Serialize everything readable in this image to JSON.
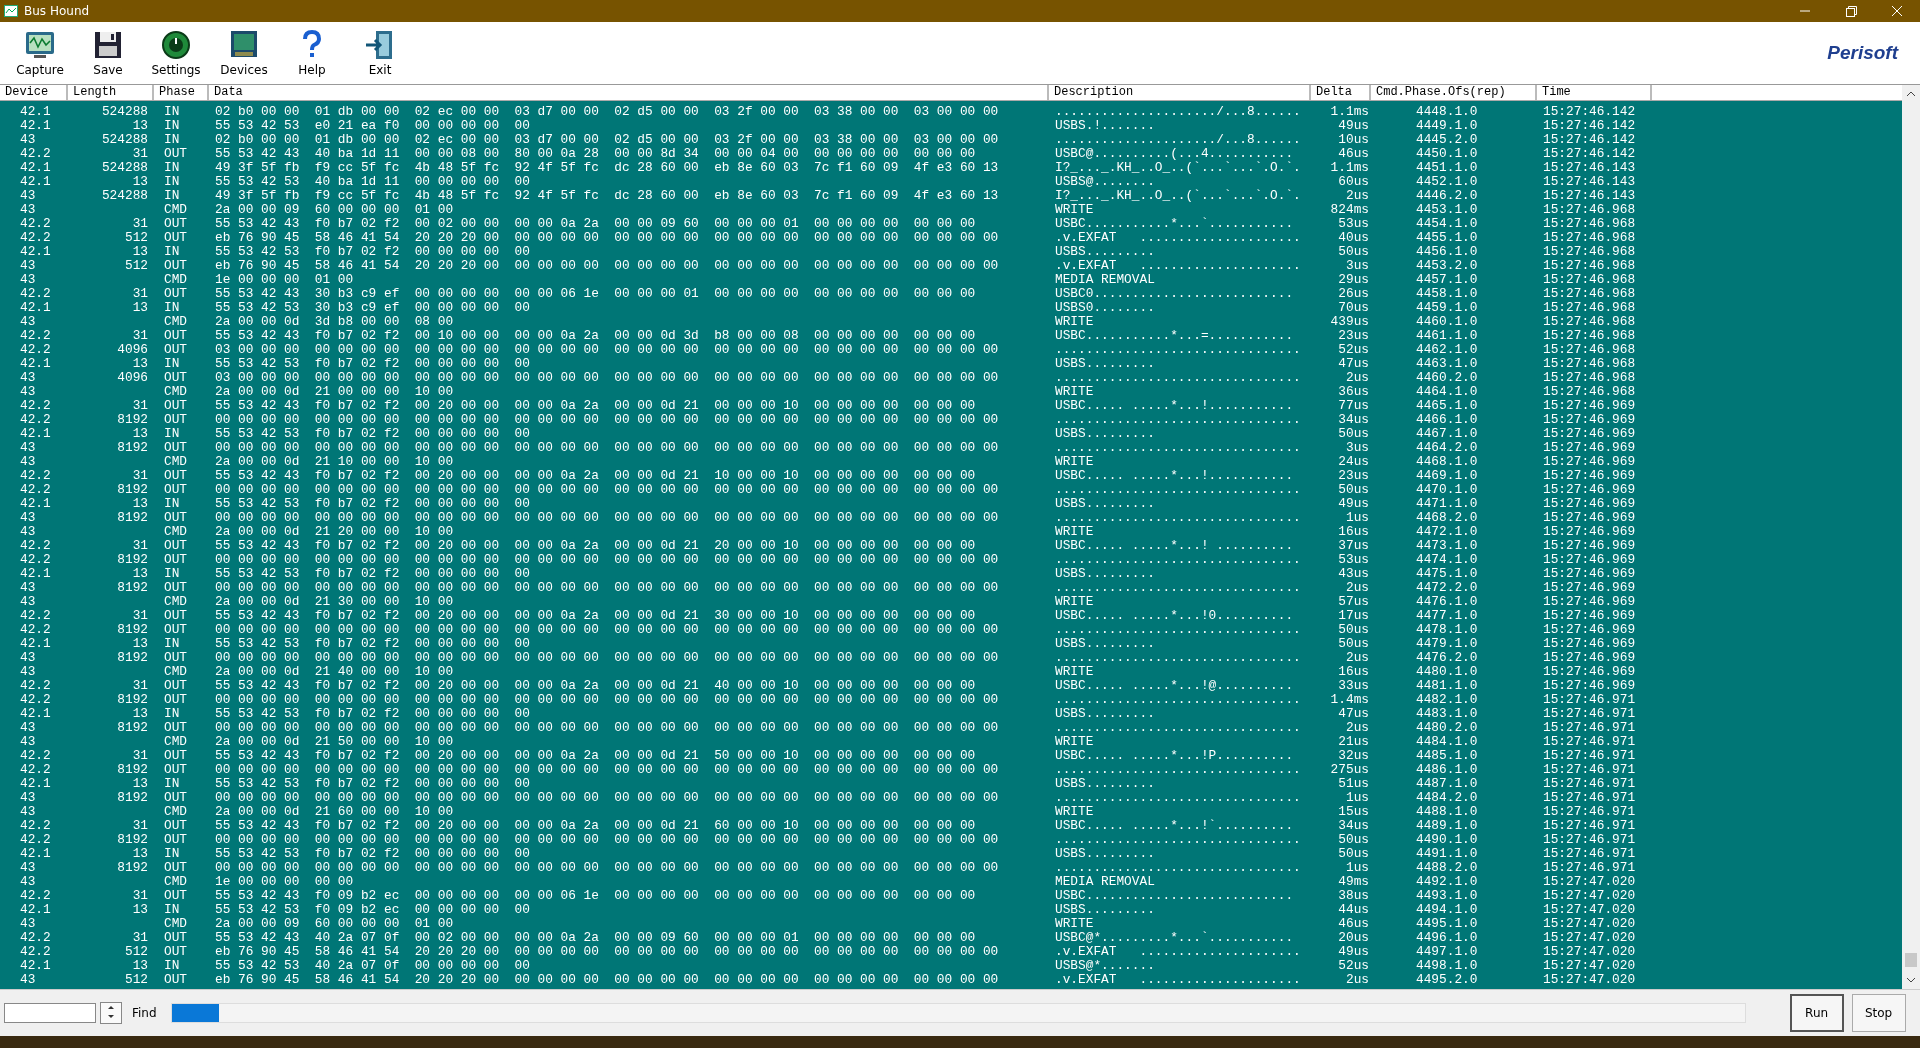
{
  "window": {
    "title": "Bus Hound"
  },
  "toolbar": [
    {
      "label": "Capture",
      "kind": "capture"
    },
    {
      "label": "Save",
      "kind": "save"
    },
    {
      "label": "Settings",
      "kind": "settings"
    },
    {
      "label": "Devices",
      "kind": "devices"
    },
    {
      "label": "Help",
      "kind": "help"
    },
    {
      "label": "Exit",
      "kind": "exit"
    }
  ],
  "logo": "Perisoft",
  "table": {
    "columns": [
      "Device",
      "Length",
      "Phase",
      "Data",
      "Description",
      "Delta",
      "Cmd.Phase.Ofs(rep)",
      "Time"
    ],
    "rows": [
      {
        "device": "42.1",
        "length": "524288",
        "phase": "IN",
        "data": "02 b0 00 00  01 db 00 00  02 ec 00 00  03 d7 00 00  02 d5 00 00  03 2f 00 00  03 38 00 00  03 00 00 00",
        "description": "...................../...8......",
        "delta": "1.1ms",
        "cmd": "4448.1.0",
        "time": "15:27:46.142"
      },
      {
        "device": "42.1",
        "length": "13",
        "phase": "IN",
        "data": "55 53 42 53  e0 21 ea f0  00 00 00 00  00",
        "description": "USBS.!.......",
        "delta": "49us",
        "cmd": "4449.1.0",
        "time": "15:27:46.142"
      },
      {
        "device": "43",
        "length": "524288",
        "phase": "IN",
        "data": "02 b0 00 00  01 db 00 00  02 ec 00 00  03 d7 00 00  02 d5 00 00  03 2f 00 00  03 38 00 00  03 00 00 00",
        "description": "...................../...8......",
        "delta": "10us",
        "cmd": "4445.2.0",
        "time": "15:27:46.142"
      },
      {
        "device": "42.2",
        "length": "31",
        "phase": "OUT",
        "data": "55 53 42 43  40 ba 1d 11  00 00 08 00  80 00 0a 28  00 00 8d 34  00 00 04 00  00 00 00 00  00 00 00",
        "description": "USBC@..........(...4...........",
        "delta": "46us",
        "cmd": "4450.1.0",
        "time": "15:27:46.142"
      },
      {
        "device": "42.1",
        "length": "524288",
        "phase": "IN",
        "data": "49 3f 5f fb  f9 cc 5f fc  4b 48 5f fc  92 4f 5f fc  dc 28 60 00  eb 8e 60 03  7c f1 60 09  4f e3 60 13",
        "description": "I?_..._.KH_..O_..(`...`...`.O.`.",
        "delta": "1.1ms",
        "cmd": "4451.1.0",
        "time": "15:27:46.143"
      },
      {
        "device": "42.1",
        "length": "13",
        "phase": "IN",
        "data": "55 53 42 53  40 ba 1d 11  00 00 00 00  00",
        "description": "USBS@........",
        "delta": "60us",
        "cmd": "4452.1.0",
        "time": "15:27:46.143"
      },
      {
        "device": "43",
        "length": "524288",
        "phase": "IN",
        "data": "49 3f 5f fb  f9 cc 5f fc  4b 48 5f fc  92 4f 5f fc  dc 28 60 00  eb 8e 60 03  7c f1 60 09  4f e3 60 13",
        "description": "I?_..._.KH_..O_..(`...`...`.O.`.",
        "delta": "2us",
        "cmd": "4446.2.0",
        "time": "15:27:46.143"
      },
      {
        "device": "43",
        "phase": "CMD",
        "data": "2a 00 00 09  60 00 00 00  01 00",
        "description": "WRITE",
        "delta": "824ms",
        "cmd": "4453.1.0",
        "time": "15:27:46.968"
      },
      {
        "device": "42.2",
        "length": "31",
        "phase": "OUT",
        "data": "55 53 42 43  f0 b7 02 f2  00 02 00 00  00 00 0a 2a  00 00 09 60  00 00 00 01  00 00 00 00  00 00 00",
        "description": "USBC...........*...`...........",
        "delta": "53us",
        "cmd": "4454.1.0",
        "time": "15:27:46.968"
      },
      {
        "device": "42.2",
        "length": "512",
        "phase": "OUT",
        "data": "eb 76 90 45  58 46 41 54  20 20 20 00  00 00 00 00  00 00 00 00  00 00 00 00  00 00 00 00  00 00 00 00",
        "description": ".v.EXFAT   .....................",
        "delta": "40us",
        "cmd": "4455.1.0",
        "time": "15:27:46.968"
      },
      {
        "device": "42.1",
        "length": "13",
        "phase": "IN",
        "data": "55 53 42 53  f0 b7 02 f2  00 00 00 00  00",
        "description": "USBS.........",
        "delta": "50us",
        "cmd": "4456.1.0",
        "time": "15:27:46.968"
      },
      {
        "device": "43",
        "length": "512",
        "phase": "OUT",
        "data": "eb 76 90 45  58 46 41 54  20 20 20 00  00 00 00 00  00 00 00 00  00 00 00 00  00 00 00 00  00 00 00 00",
        "description": ".v.EXFAT   .....................",
        "delta": "3us",
        "cmd": "4453.2.0",
        "time": "15:27:46.968"
      },
      {
        "device": "43",
        "phase": "CMD",
        "data": "1e 00 00 00  01 00",
        "description": "MEDIA REMOVAL",
        "delta": "29us",
        "cmd": "4457.1.0",
        "time": "15:27:46.968"
      },
      {
        "device": "42.2",
        "length": "31",
        "phase": "OUT",
        "data": "55 53 42 43  30 b3 c9 ef  00 00 00 00  00 00 06 1e  00 00 00 01  00 00 00 00  00 00 00 00  00 00 00",
        "description": "USBC0..........................",
        "delta": "26us",
        "cmd": "4458.1.0",
        "time": "15:27:46.968"
      },
      {
        "device": "42.1",
        "length": "13",
        "phase": "IN",
        "data": "55 53 42 53  30 b3 c9 ef  00 00 00 00  00",
        "description": "USBS0........",
        "delta": "70us",
        "cmd": "4459.1.0",
        "time": "15:27:46.968"
      },
      {
        "device": "43",
        "phase": "CMD",
        "data": "2a 00 00 0d  3d b8 00 00  08 00",
        "description": "WRITE",
        "delta": "439us",
        "cmd": "4460.1.0",
        "time": "15:27:46.968"
      },
      {
        "device": "42.2",
        "length": "31",
        "phase": "OUT",
        "data": "55 53 42 43  f0 b7 02 f2  00 10 00 00  00 00 0a 2a  00 00 0d 3d  b8 00 00 08  00 00 00 00  00 00 00",
        "description": "USBC...........*...=...........",
        "delta": "23us",
        "cmd": "4461.1.0",
        "time": "15:27:46.968"
      },
      {
        "device": "42.2",
        "length": "4096",
        "phase": "OUT",
        "data": "03 00 00 00  00 00 00 00  00 00 00 00  00 00 00 00  00 00 00 00  00 00 00 00  00 00 00 00  00 00 00 00",
        "description": "................................",
        "delta": "52us",
        "cmd": "4462.1.0",
        "time": "15:27:46.968"
      },
      {
        "device": "42.1",
        "length": "13",
        "phase": "IN",
        "data": "55 53 42 53  f0 b7 02 f2  00 00 00 00  00",
        "description": "USBS.........",
        "delta": "47us",
        "cmd": "4463.1.0",
        "time": "15:27:46.968"
      },
      {
        "device": "43",
        "length": "4096",
        "phase": "OUT",
        "data": "03 00 00 00  00 00 00 00  00 00 00 00  00 00 00 00  00 00 00 00  00 00 00 00  00 00 00 00  00 00 00 00",
        "description": "................................",
        "delta": "2us",
        "cmd": "4460.2.0",
        "time": "15:27:46.968"
      },
      {
        "device": "43",
        "phase": "CMD",
        "data": "2a 00 00 0d  21 00 00 00  10 00",
        "description": "WRITE",
        "delta": "36us",
        "cmd": "4464.1.0",
        "time": "15:27:46.968"
      },
      {
        "device": "42.2",
        "length": "31",
        "phase": "OUT",
        "data": "55 53 42 43  f0 b7 02 f2  00 20 00 00  00 00 0a 2a  00 00 0d 21  00 00 00 10  00 00 00 00  00 00 00",
        "description": "USBC..... .....*...!...........",
        "delta": "77us",
        "cmd": "4465.1.0",
        "time": "15:27:46.969"
      },
      {
        "device": "42.2",
        "length": "8192",
        "phase": "OUT",
        "data": "00 00 00 00  00 00 00 00  00 00 00 00  00 00 00 00  00 00 00 00  00 00 00 00  00 00 00 00  00 00 00 00",
        "description": "................................",
        "delta": "34us",
        "cmd": "4466.1.0",
        "time": "15:27:46.969"
      },
      {
        "device": "42.1",
        "length": "13",
        "phase": "IN",
        "data": "55 53 42 53  f0 b7 02 f2  00 00 00 00  00",
        "description": "USBS.........",
        "delta": "50us",
        "cmd": "4467.1.0",
        "time": "15:27:46.969"
      },
      {
        "device": "43",
        "length": "8192",
        "phase": "OUT",
        "data": "00 00 00 00  00 00 00 00  00 00 00 00  00 00 00 00  00 00 00 00  00 00 00 00  00 00 00 00  00 00 00 00",
        "description": "................................",
        "delta": "3us",
        "cmd": "4464.2.0",
        "time": "15:27:46.969"
      },
      {
        "device": "43",
        "phase": "CMD",
        "data": "2a 00 00 0d  21 10 00 00  10 00",
        "description": "WRITE",
        "delta": "24us",
        "cmd": "4468.1.0",
        "time": "15:27:46.969"
      },
      {
        "device": "42.2",
        "length": "31",
        "phase": "OUT",
        "data": "55 53 42 43  f0 b7 02 f2  00 20 00 00  00 00 0a 2a  00 00 0d 21  10 00 00 10  00 00 00 00  00 00 00",
        "description": "USBC..... .....*...!...........",
        "delta": "23us",
        "cmd": "4469.1.0",
        "time": "15:27:46.969"
      },
      {
        "device": "42.2",
        "length": "8192",
        "phase": "OUT",
        "data": "00 00 00 00  00 00 00 00  00 00 00 00  00 00 00 00  00 00 00 00  00 00 00 00  00 00 00 00  00 00 00 00",
        "description": "................................",
        "delta": "50us",
        "cmd": "4470.1.0",
        "time": "15:27:46.969"
      },
      {
        "device": "42.1",
        "length": "13",
        "phase": "IN",
        "data": "55 53 42 53  f0 b7 02 f2  00 00 00 00  00",
        "description": "USBS.........",
        "delta": "49us",
        "cmd": "4471.1.0",
        "time": "15:27:46.969"
      },
      {
        "device": "43",
        "length": "8192",
        "phase": "OUT",
        "data": "00 00 00 00  00 00 00 00  00 00 00 00  00 00 00 00  00 00 00 00  00 00 00 00  00 00 00 00  00 00 00 00",
        "description": "................................",
        "delta": "1us",
        "cmd": "4468.2.0",
        "time": "15:27:46.969"
      },
      {
        "device": "43",
        "phase": "CMD",
        "data": "2a 00 00 0d  21 20 00 00  10 00",
        "description": "WRITE",
        "delta": "16us",
        "cmd": "4472.1.0",
        "time": "15:27:46.969"
      },
      {
        "device": "42.2",
        "length": "31",
        "phase": "OUT",
        "data": "55 53 42 43  f0 b7 02 f2  00 20 00 00  00 00 0a 2a  00 00 0d 21  20 00 00 10  00 00 00 00  00 00 00",
        "description": "USBC..... .....*...! ..........",
        "delta": "37us",
        "cmd": "4473.1.0",
        "time": "15:27:46.969"
      },
      {
        "device": "42.2",
        "length": "8192",
        "phase": "OUT",
        "data": "00 00 00 00  00 00 00 00  00 00 00 00  00 00 00 00  00 00 00 00  00 00 00 00  00 00 00 00  00 00 00 00",
        "description": "................................",
        "delta": "53us",
        "cmd": "4474.1.0",
        "time": "15:27:46.969"
      },
      {
        "device": "42.1",
        "length": "13",
        "phase": "IN",
        "data": "55 53 42 53  f0 b7 02 f2  00 00 00 00  00",
        "description": "USBS.........",
        "delta": "43us",
        "cmd": "4475.1.0",
        "time": "15:27:46.969"
      },
      {
        "device": "43",
        "length": "8192",
        "phase": "OUT",
        "data": "00 00 00 00  00 00 00 00  00 00 00 00  00 00 00 00  00 00 00 00  00 00 00 00  00 00 00 00  00 00 00 00",
        "description": "................................",
        "delta": "2us",
        "cmd": "4472.2.0",
        "time": "15:27:46.969"
      },
      {
        "device": "43",
        "phase": "CMD",
        "data": "2a 00 00 0d  21 30 00 00  10 00",
        "description": "WRITE",
        "delta": "57us",
        "cmd": "4476.1.0",
        "time": "15:27:46.969"
      },
      {
        "device": "42.2",
        "length": "31",
        "phase": "OUT",
        "data": "55 53 42 43  f0 b7 02 f2  00 20 00 00  00 00 0a 2a  00 00 0d 21  30 00 00 10  00 00 00 00  00 00 00",
        "description": "USBC..... .....*...!0..........",
        "delta": "17us",
        "cmd": "4477.1.0",
        "time": "15:27:46.969"
      },
      {
        "device": "42.2",
        "length": "8192",
        "phase": "OUT",
        "data": "00 00 00 00  00 00 00 00  00 00 00 00  00 00 00 00  00 00 00 00  00 00 00 00  00 00 00 00  00 00 00 00",
        "description": "................................",
        "delta": "50us",
        "cmd": "4478.1.0",
        "time": "15:27:46.969"
      },
      {
        "device": "42.1",
        "length": "13",
        "phase": "IN",
        "data": "55 53 42 53  f0 b7 02 f2  00 00 00 00  00",
        "description": "USBS.........",
        "delta": "50us",
        "cmd": "4479.1.0",
        "time": "15:27:46.969"
      },
      {
        "device": "43",
        "length": "8192",
        "phase": "OUT",
        "data": "00 00 00 00  00 00 00 00  00 00 00 00  00 00 00 00  00 00 00 00  00 00 00 00  00 00 00 00  00 00 00 00",
        "description": "................................",
        "delta": "2us",
        "cmd": "4476.2.0",
        "time": "15:27:46.969"
      },
      {
        "device": "43",
        "phase": "CMD",
        "data": "2a 00 00 0d  21 40 00 00  10 00",
        "description": "WRITE",
        "delta": "16us",
        "cmd": "4480.1.0",
        "time": "15:27:46.969"
      },
      {
        "device": "42.2",
        "length": "31",
        "phase": "OUT",
        "data": "55 53 42 43  f0 b7 02 f2  00 20 00 00  00 00 0a 2a  00 00 0d 21  40 00 00 10  00 00 00 00  00 00 00",
        "description": "USBC..... .....*...!@..........",
        "delta": "33us",
        "cmd": "4481.1.0",
        "time": "15:27:46.969"
      },
      {
        "device": "42.2",
        "length": "8192",
        "phase": "OUT",
        "data": "00 00 00 00  00 00 00 00  00 00 00 00  00 00 00 00  00 00 00 00  00 00 00 00  00 00 00 00  00 00 00 00",
        "description": "................................",
        "delta": "1.4ms",
        "cmd": "4482.1.0",
        "time": "15:27:46.971"
      },
      {
        "device": "42.1",
        "length": "13",
        "phase": "IN",
        "data": "55 53 42 53  f0 b7 02 f2  00 00 00 00  00",
        "description": "USBS.........",
        "delta": "47us",
        "cmd": "4483.1.0",
        "time": "15:27:46.971"
      },
      {
        "device": "43",
        "length": "8192",
        "phase": "OUT",
        "data": "00 00 00 00  00 00 00 00  00 00 00 00  00 00 00 00  00 00 00 00  00 00 00 00  00 00 00 00  00 00 00 00",
        "description": "................................",
        "delta": "2us",
        "cmd": "4480.2.0",
        "time": "15:27:46.971"
      },
      {
        "device": "43",
        "phase": "CMD",
        "data": "2a 00 00 0d  21 50 00 00  10 00",
        "description": "WRITE",
        "delta": "21us",
        "cmd": "4484.1.0",
        "time": "15:27:46.971"
      },
      {
        "device": "42.2",
        "length": "31",
        "phase": "OUT",
        "data": "55 53 42 43  f0 b7 02 f2  00 20 00 00  00 00 0a 2a  00 00 0d 21  50 00 00 10  00 00 00 00  00 00 00",
        "description": "USBC..... .....*...!P..........",
        "delta": "32us",
        "cmd": "4485.1.0",
        "time": "15:27:46.971"
      },
      {
        "device": "42.2",
        "length": "8192",
        "phase": "OUT",
        "data": "00 00 00 00  00 00 00 00  00 00 00 00  00 00 00 00  00 00 00 00  00 00 00 00  00 00 00 00  00 00 00 00",
        "description": "................................",
        "delta": "275us",
        "cmd": "4486.1.0",
        "time": "15:27:46.971"
      },
      {
        "device": "42.1",
        "length": "13",
        "phase": "IN",
        "data": "55 53 42 53  f0 b7 02 f2  00 00 00 00  00",
        "description": "USBS.........",
        "delta": "51us",
        "cmd": "4487.1.0",
        "time": "15:27:46.971"
      },
      {
        "device": "43",
        "length": "8192",
        "phase": "OUT",
        "data": "00 00 00 00  00 00 00 00  00 00 00 00  00 00 00 00  00 00 00 00  00 00 00 00  00 00 00 00  00 00 00 00",
        "description": "................................",
        "delta": "1us",
        "cmd": "4484.2.0",
        "time": "15:27:46.971"
      },
      {
        "device": "43",
        "phase": "CMD",
        "data": "2a 00 00 0d  21 60 00 00  10 00",
        "description": "WRITE",
        "delta": "15us",
        "cmd": "4488.1.0",
        "time": "15:27:46.971"
      },
      {
        "device": "42.2",
        "length": "31",
        "phase": "OUT",
        "data": "55 53 42 43  f0 b7 02 f2  00 20 00 00  00 00 0a 2a  00 00 0d 21  60 00 00 10  00 00 00 00  00 00 00",
        "description": "USBC..... .....*...!`..........",
        "delta": "34us",
        "cmd": "4489.1.0",
        "time": "15:27:46.971"
      },
      {
        "device": "42.2",
        "length": "8192",
        "phase": "OUT",
        "data": "00 00 00 00  00 00 00 00  00 00 00 00  00 00 00 00  00 00 00 00  00 00 00 00  00 00 00 00  00 00 00 00",
        "description": "................................",
        "delta": "50us",
        "cmd": "4490.1.0",
        "time": "15:27:46.971"
      },
      {
        "device": "42.1",
        "length": "13",
        "phase": "IN",
        "data": "55 53 42 53  f0 b7 02 f2  00 00 00 00  00",
        "description": "USBS.........",
        "delta": "50us",
        "cmd": "4491.1.0",
        "time": "15:27:46.971"
      },
      {
        "device": "43",
        "length": "8192",
        "phase": "OUT",
        "data": "00 00 00 00  00 00 00 00  00 00 00 00  00 00 00 00  00 00 00 00  00 00 00 00  00 00 00 00  00 00 00 00",
        "description": "................................",
        "delta": "1us",
        "cmd": "4488.2.0",
        "time": "15:27:46.971"
      },
      {
        "device": "43",
        "phase": "CMD",
        "data": "1e 00 00 00  00 00",
        "description": "MEDIA REMOVAL",
        "delta": "49ms",
        "cmd": "4492.1.0",
        "time": "15:27:47.020"
      },
      {
        "device": "42.2",
        "length": "31",
        "phase": "OUT",
        "data": "55 53 42 43  f0 09 b2 ec  00 00 00 00  00 00 06 1e  00 00 00 00  00 00 00 00  00 00 00 00  00 00 00",
        "description": "USBC...........................",
        "delta": "38us",
        "cmd": "4493.1.0",
        "time": "15:27:47.020"
      },
      {
        "device": "42.1",
        "length": "13",
        "phase": "IN",
        "data": "55 53 42 53  f0 09 b2 ec  00 00 00 00  00",
        "description": "USBS.........",
        "delta": "44us",
        "cmd": "4494.1.0",
        "time": "15:27:47.020"
      },
      {
        "device": "43",
        "phase": "CMD",
        "data": "2a 00 00 09  60 00 00 00  01 00",
        "description": "WRITE",
        "delta": "46us",
        "cmd": "4495.1.0",
        "time": "15:27:47.020"
      },
      {
        "device": "42.2",
        "length": "31",
        "phase": "OUT",
        "data": "55 53 42 43  40 2a 07 0f  00 02 00 00  00 00 0a 2a  00 00 09 60  00 00 00 01  00 00 00 00  00 00 00",
        "description": "USBC@*.........*...`...........",
        "delta": "20us",
        "cmd": "4496.1.0",
        "time": "15:27:47.020"
      },
      {
        "device": "42.2",
        "length": "512",
        "phase": "OUT",
        "data": "eb 76 90 45  58 46 41 54  20 20 20 00  00 00 00 00  00 00 00 00  00 00 00 00  00 00 00 00  00 00 00 00",
        "description": ".v.EXFAT   .....................",
        "delta": "49us",
        "cmd": "4497.1.0",
        "time": "15:27:47.020"
      },
      {
        "device": "42.1",
        "length": "13",
        "phase": "IN",
        "data": "55 53 42 53  40 2a 07 0f  00 00 00 00  00",
        "description": "USBS@*.......",
        "delta": "52us",
        "cmd": "4498.1.0",
        "time": "15:27:47.020"
      },
      {
        "device": "43",
        "length": "512",
        "phase": "OUT",
        "data": "eb 76 90 45  58 46 41 54  20 20 20 00  00 00 00 00  00 00 00 00  00 00 00 00  00 00 00 00  00 00 00 00",
        "description": ".v.EXFAT   .....................",
        "delta": "2us",
        "cmd": "4495.2.0",
        "time": "15:27:47.020"
      }
    ]
  },
  "bottom": {
    "find_label": "Find",
    "progress": {
      "level": 0.03
    },
    "buttons": [
      "Run",
      "Stop"
    ]
  }
}
